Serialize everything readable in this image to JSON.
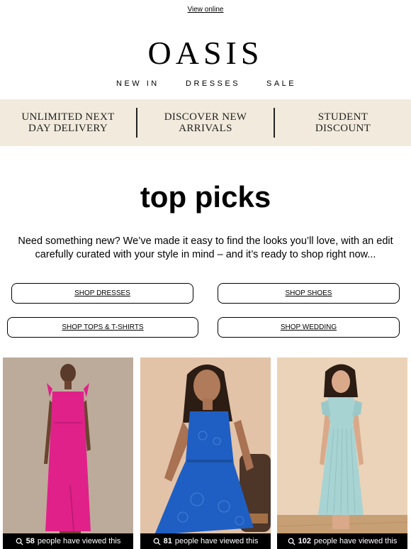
{
  "header": {
    "view_online": "View online",
    "logo": "OASIS"
  },
  "nav": {
    "items": [
      "NEW IN",
      "DRESSES",
      "SALE"
    ]
  },
  "promo": {
    "items": [
      {
        "line1": "UNLIMITED NEXT",
        "line2": "DAY DELIVERY"
      },
      {
        "line1": "DISCOVER NEW",
        "line2": "ARRIVALS"
      },
      {
        "line1": "STUDENT",
        "line2": "DISCOUNT"
      }
    ],
    "background": "#f2ebdd"
  },
  "main": {
    "heading": "top picks",
    "intro": "Need something new? We’ve made it easy to find the looks you’ll love, with an edit carefully curated with your style in mind – and it’s ready to shop right now...",
    "buttons": [
      "SHOP DRESSES",
      "SHOP SHOES",
      "SHOP TOPS & T-SHIRTS",
      "SHOP WEDDING"
    ]
  },
  "products": [
    {
      "count": "58",
      "viewed_text": "people have viewed this",
      "color": "#e0218a",
      "icon": "search-icon"
    },
    {
      "count": "81",
      "viewed_text": "people have viewed this",
      "color": "#1f5fc4",
      "icon": "search-icon"
    },
    {
      "count": "102",
      "viewed_text": "people have viewed this",
      "color": "#a8d3d3",
      "icon": "search-icon"
    }
  ]
}
